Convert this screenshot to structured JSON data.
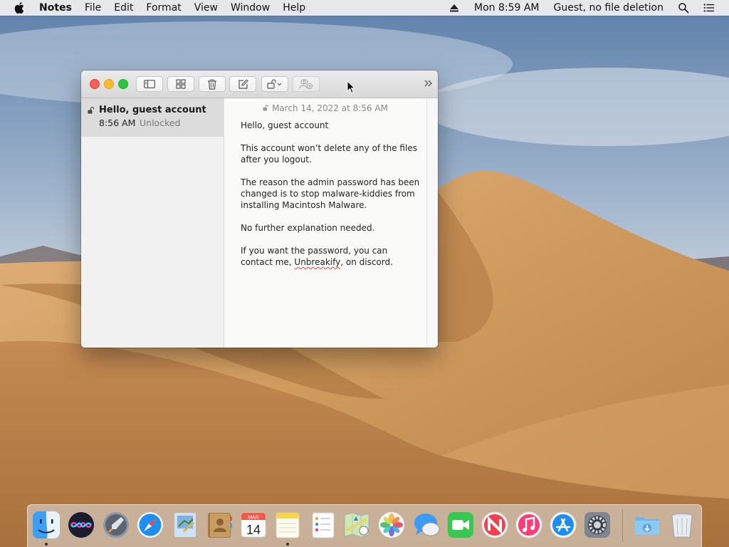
{
  "menubar": {
    "app_name": "Notes",
    "menus": [
      "File",
      "Edit",
      "Format",
      "View",
      "Window",
      "Help"
    ],
    "clock": "Mon 8:59 AM",
    "user": "Guest, no file deletion"
  },
  "sidebar": {
    "notes": [
      {
        "title": "Hello, guest account",
        "time": "8:56 AM",
        "state": "Unlocked"
      }
    ]
  },
  "note": {
    "date": "March 14, 2022 at 8:56 AM",
    "lines": [
      "Hello, guest account",
      "",
      "This account won’t delete any of the files",
      "after you logout.",
      "",
      "The reason the admin password has been",
      "changed is to stop malware-kiddies from",
      "installing Macintosh Malware.",
      "",
      "No further explanation needed.",
      "",
      "If you want the password, you can",
      "contact me, ",
      "Unbreakify",
      ", on discord."
    ]
  },
  "dock": {
    "icons": [
      "finder-icon",
      "siri-icon",
      "launchpad-icon",
      "safari-icon",
      "mail-icon",
      "contacts-icon",
      "calendar-icon",
      "notes-icon",
      "reminders-icon",
      "maps-icon",
      "photos-icon",
      "messages-icon",
      "facetime-icon",
      "news-icon",
      "itunes-icon",
      "app-store-icon",
      "system-preferences-icon",
      "downloads-folder-icon",
      "trash-icon"
    ],
    "calendar_month": "MAR",
    "calendar_day": "14"
  },
  "colors": {
    "close": "#fc5f57",
    "minimize": "#fdbc2e",
    "zoom": "#28c840",
    "spellcheck": "#e0443e"
  }
}
